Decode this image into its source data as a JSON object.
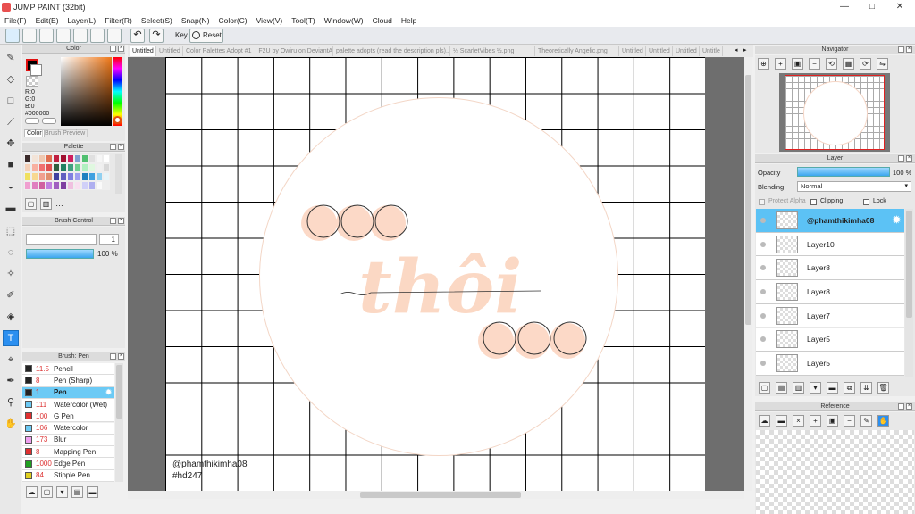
{
  "app": {
    "title": "JUMP PAINT (32bit)"
  },
  "menu": [
    "File(F)",
    "Edit(E)",
    "Layer(L)",
    "Filter(R)",
    "Select(S)",
    "Snap(N)",
    "Color(C)",
    "View(V)",
    "Tool(T)",
    "Window(W)",
    "Cloud",
    "Help"
  ],
  "toolbar": {
    "key_label": "Key",
    "reset_label": "Reset"
  },
  "tabs": [
    "Untitled",
    "Untitled",
    "Color Palettes Adopt #1 _ F2U by Owiru on DeviantArt.png",
    "palette adopts (read the description pls)..",
    "½ ScarletVibes ½.png",
    "Theoretically Angelic.png",
    "Untitled",
    "Untitled",
    "Untitled",
    "Untitle"
  ],
  "color_panel": {
    "title": "Color",
    "r": "R:0",
    "g": "G:0",
    "b": "B:0",
    "hex": "#000000",
    "tab_color": "Color",
    "tab_brush_preview": "Brush Preview",
    "fg_color": "#000000"
  },
  "palette_panel": {
    "title": "Palette",
    "more": "…",
    "swatches": [
      "#3a2a2a",
      "#f3e4d8",
      "#f0c8b0",
      "#e07050",
      "#c02040",
      "#a01030",
      "#d02060",
      "#80a0d0",
      "#50c070",
      "#e0e0e0",
      "#f6f6f6",
      "#ffffff",
      "#f4d0b8",
      "#f8b0a0",
      "#f07070",
      "#e05050",
      "#306040",
      "#208060",
      "#40a080",
      "#70d090",
      "#b0f0c0",
      "#e0f8e0",
      "#f0f0f0",
      "#d8d8d8",
      "#f0e060",
      "#f8d890",
      "#f0a090",
      "#e09070",
      "#4040a0",
      "#6060c0",
      "#8080e0",
      "#a0a0f0",
      "#2080c0",
      "#40a0e0",
      "#90d0f0",
      "#e8f4f8",
      "#f0a0d0",
      "#e080c0",
      "#d060a0",
      "#c080e0",
      "#a060c0",
      "#8040a0",
      "#f0c0e0",
      "#f8e0f0",
      "#d0d0f8",
      "#b0b0f0",
      "#fafafa",
      "#eeeeee"
    ]
  },
  "brush_control": {
    "title": "Brush Control",
    "size": "1",
    "opacity": "100 %"
  },
  "brush_panel": {
    "title": "Brush: Pen",
    "brushes": [
      {
        "size": "11.5",
        "name": "Pencil",
        "color": "#222222"
      },
      {
        "size": "8",
        "name": "Pen (Sharp)",
        "color": "#222222"
      },
      {
        "size": "1",
        "name": "Pen",
        "color": "#222222"
      },
      {
        "size": "111",
        "name": "Watercolor (Wet)",
        "color": "#6ccaf5"
      },
      {
        "size": "100",
        "name": "G Pen",
        "color": "#e03030"
      },
      {
        "size": "106",
        "name": "Watercolor",
        "color": "#6ccaf5"
      },
      {
        "size": "173",
        "name": "Blur",
        "color": "#f0a0f0"
      },
      {
        "size": "8",
        "name": "Mapping Pen",
        "color": "#e03030"
      },
      {
        "size": "1000",
        "name": "Edge Pen",
        "color": "#20a020"
      },
      {
        "size": "84",
        "name": "Stipple Pen",
        "color": "#e0d020"
      }
    ]
  },
  "canvas": {
    "watermark_name": "@phamthikimha08",
    "watermark_tag": "#hd247",
    "lettering": "thôi"
  },
  "navigator": {
    "title": "Navigator"
  },
  "layer_panel": {
    "title": "Layer",
    "opacity_label": "Opacity",
    "opacity_value": "100 %",
    "blending_label": "Blending",
    "blending_value": "Normal",
    "protect_alpha": "Protect Alpha",
    "clipping": "Clipping",
    "lock": "Lock",
    "layers": [
      "@phamthikimha08",
      "Layer10",
      "Layer8",
      "Layer8",
      "Layer7",
      "Layer5",
      "Layer5"
    ]
  },
  "reference_panel": {
    "title": "Reference"
  }
}
